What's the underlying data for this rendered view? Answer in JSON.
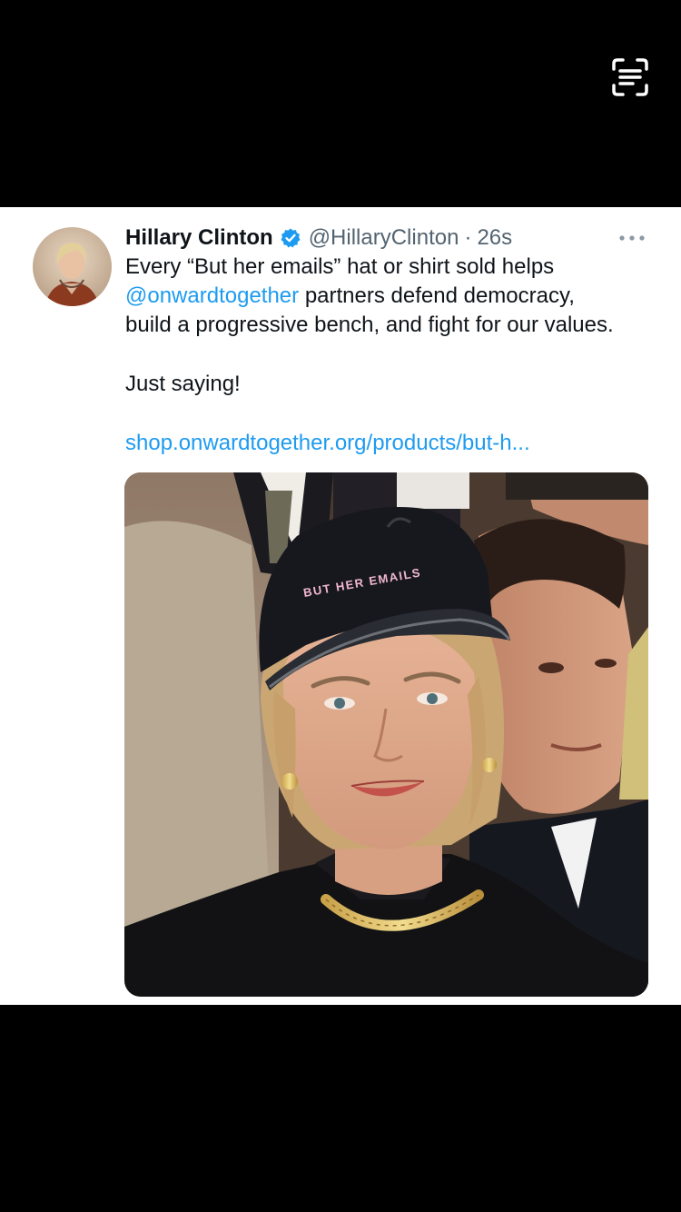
{
  "tweet": {
    "author_name": "Hillary Clinton",
    "handle": "@HillaryClinton",
    "separator": "·",
    "timestamp": "26s",
    "text_line1": "Every “But her emails” hat or shirt sold helps",
    "mention": "@onwardtogether",
    "text_line2_rest": " partners defend democracy,",
    "text_line3": "build a progressive bench, and fight for our values.",
    "text_line4": "Just saying!",
    "link_text": "shop.onwardtogether.org/products/but-h..."
  },
  "media": {
    "hat_text": "BUT HER EMAILS"
  },
  "colors": {
    "link": "#1d9bf0",
    "verified": "#1d9bf0",
    "text": "#0f1419",
    "secondary": "#536471",
    "background": "#ffffff",
    "letterbox": "#000000"
  },
  "icons": {
    "scan": "scan-text-icon",
    "verified": "verified-badge-icon",
    "more": "more-dots-icon"
  }
}
